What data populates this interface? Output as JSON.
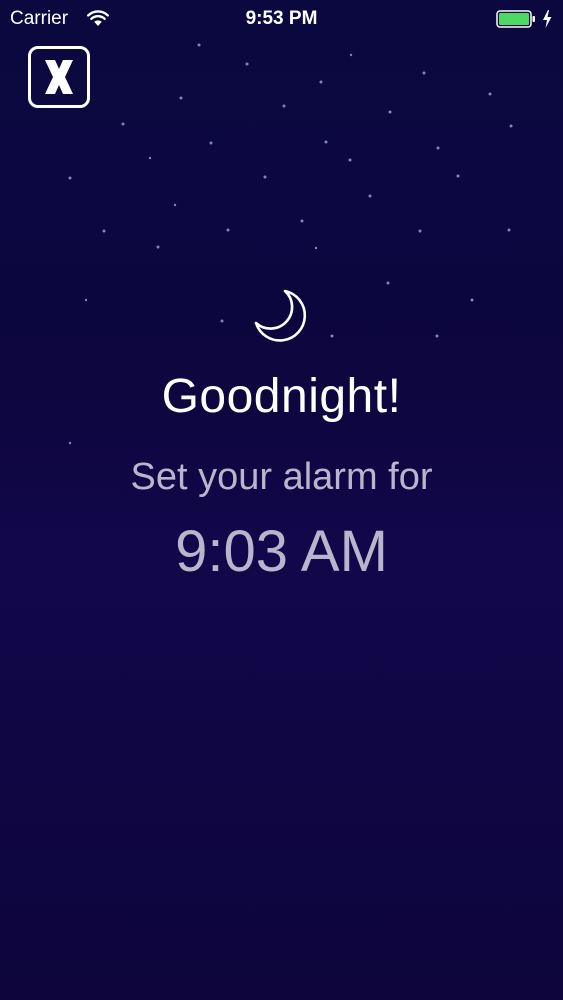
{
  "status_bar": {
    "carrier": "Carrier",
    "time": "9:53 PM",
    "battery_color": "#4cd964"
  },
  "close_button": {
    "icon": "close-icon"
  },
  "main": {
    "icon": "moon-icon",
    "title": "Goodnight!",
    "subtitle": "Set your alarm for",
    "alarm_time": "9:03 AM"
  },
  "colors": {
    "background": "#0d063f",
    "text_primary": "#ffffff",
    "text_secondary": "#b9b5cc"
  }
}
